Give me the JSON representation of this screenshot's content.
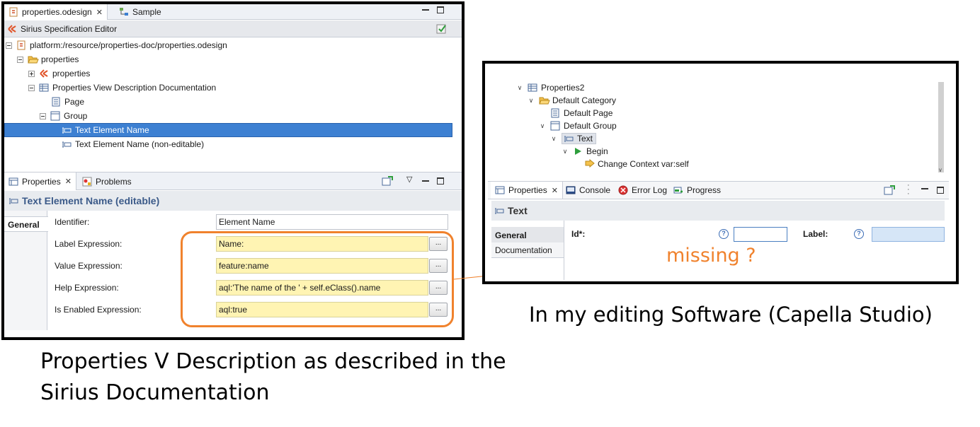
{
  "left_panel": {
    "editor_tabs": [
      {
        "label": "properties.odesign"
      },
      {
        "label": "Sample"
      }
    ],
    "editor_title": "Sirius Specification Editor",
    "tree": [
      {
        "label": "platform:/resource/properties-doc/properties.odesign"
      },
      {
        "label": "properties"
      },
      {
        "label": "properties"
      },
      {
        "label": "Properties View Description Documentation"
      },
      {
        "label": "Page"
      },
      {
        "label": "Group"
      },
      {
        "label": "Text Element Name"
      },
      {
        "label": "Text Element Name (non-editable)"
      }
    ],
    "view_tabs": [
      {
        "label": "Properties"
      },
      {
        "label": "Problems"
      }
    ],
    "header": "Text Element Name (editable)",
    "side_tab": "General",
    "fields": [
      {
        "label": "Identifier:",
        "value": "Element Name"
      },
      {
        "label": "Label Expression:",
        "value": "Name:"
      },
      {
        "label": "Value Expression:",
        "value": "feature:name"
      },
      {
        "label": "Help Expression:",
        "value": "aql:'The name of the ' + self.eClass().name"
      },
      {
        "label": "Is Enabled Expression:",
        "value": "aql:true"
      }
    ],
    "button_label": "...",
    "caption_line1": "Properties V Description as described in the",
    "caption_line2": "Sirius Documentation"
  },
  "right_panel": {
    "tree": [
      {
        "label": "Properties2"
      },
      {
        "label": "Default Category"
      },
      {
        "label": "Default Page"
      },
      {
        "label": "Default Group"
      },
      {
        "label": "Text"
      },
      {
        "label": "Begin"
      },
      {
        "label": "Change Context var:self"
      }
    ],
    "view_tabs": [
      {
        "label": "Properties"
      },
      {
        "label": "Console"
      },
      {
        "label": "Error Log"
      },
      {
        "label": "Progress"
      }
    ],
    "header": "Text",
    "side_tabs": [
      {
        "label": "General"
      },
      {
        "label": "Documentation"
      }
    ],
    "id_label": "Id*:",
    "label_label": "Label:",
    "caption": "In my editing Software (Capella Studio)"
  },
  "annotation": {
    "text": "missing ?",
    "color": "#f0822d"
  },
  "colors": {
    "selection": "#3d80d2",
    "expression_field": "#fff4b3",
    "header_text": "#3b5a89"
  }
}
